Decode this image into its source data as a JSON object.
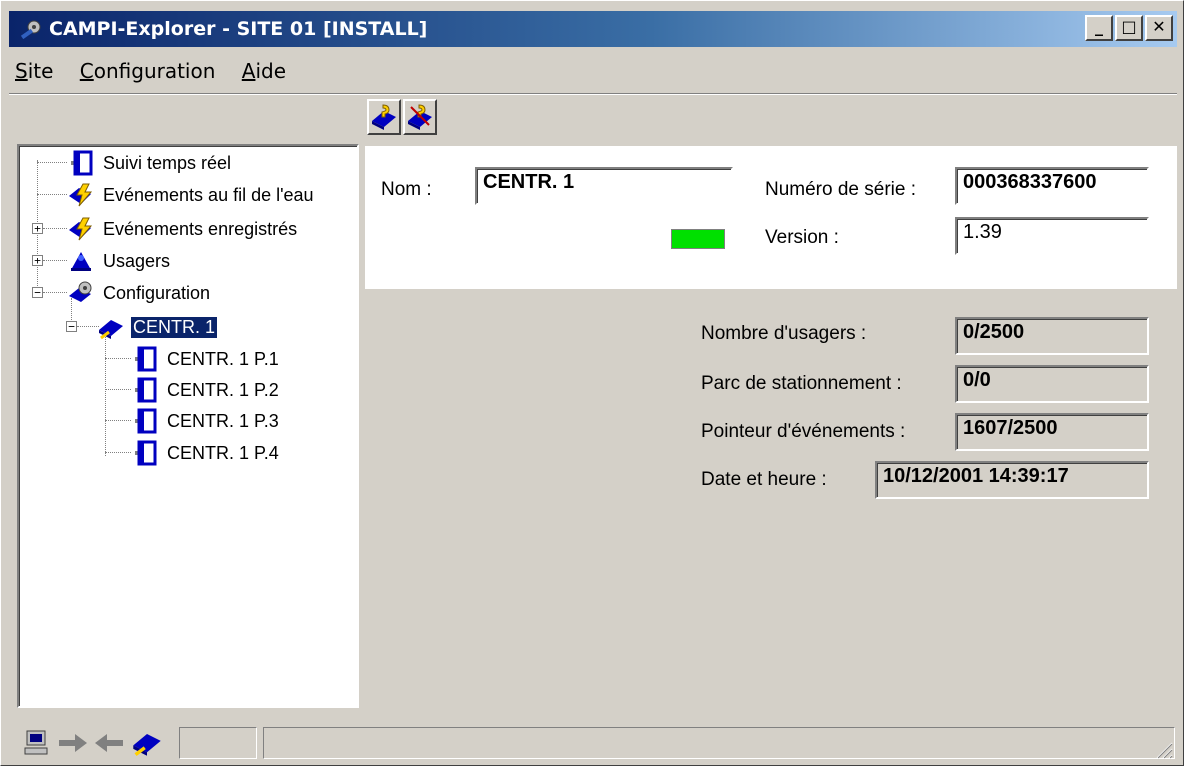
{
  "window": {
    "title": "CAMPI-Explorer - SITE 01 [INSTALL]",
    "controls": {
      "minimize": "_",
      "maximize": "□",
      "close": "✕"
    }
  },
  "menu": [
    {
      "label": "Site",
      "accel": "S",
      "rest": "ite"
    },
    {
      "label": "Configuration",
      "accel": "C",
      "rest": "onfiguration"
    },
    {
      "label": "Aide",
      "accel": "A",
      "rest": "ide"
    }
  ],
  "toolbar": {
    "buttons": [
      {
        "icon": "central-connect-icon"
      },
      {
        "icon": "central-disconnect-icon"
      }
    ]
  },
  "tree": {
    "nodes": [
      {
        "label": "Suivi temps réel",
        "icon": "door-icon"
      },
      {
        "label": "Evénements au fil de l'eau",
        "icon": "lightning-icon"
      },
      {
        "label": "Evénements enregistrés",
        "icon": "lightning-icon",
        "expander": "+"
      },
      {
        "label": "Usagers",
        "icon": "users-icon",
        "expander": "+"
      },
      {
        "label": "Configuration",
        "icon": "config-icon",
        "expander": "−"
      },
      {
        "label": "CENTR. 1",
        "icon": "central-icon",
        "expander": "−",
        "selected": true
      },
      {
        "label": "CENTR. 1 P.1",
        "icon": "door-icon"
      },
      {
        "label": "CENTR. 1 P.2",
        "icon": "door-icon"
      },
      {
        "label": "CENTR. 1 P.3",
        "icon": "door-icon"
      },
      {
        "label": "CENTR. 1 P.4",
        "icon": "door-icon"
      }
    ]
  },
  "details": {
    "nom_label": "Nom :",
    "nom_value": "CENTR. 1",
    "serie_label": "Numéro de série :",
    "serie_value": "000368337600",
    "version_label": "Version :",
    "version_value": "1.39",
    "status_color": "#00e000"
  },
  "stats": {
    "usagers_label": "Nombre d'usagers :",
    "usagers_value": "0/2500",
    "parc_label": "Parc de stationnement :",
    "parc_value": "0/0",
    "pointeur_label": "Pointeur d'événements :",
    "pointeur_value": "1607/2500",
    "date_label": "Date et heure :",
    "date_value": "10/12/2001 14:39:17"
  },
  "statusbar": {
    "icons": [
      "computer-icon",
      "arrow-right-icon",
      "arrow-left-icon",
      "central-icon"
    ]
  }
}
